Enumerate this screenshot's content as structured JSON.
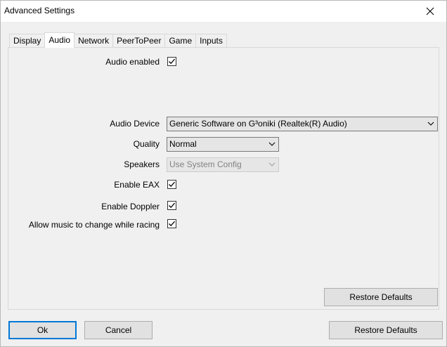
{
  "window": {
    "title": "Advanced Settings"
  },
  "tabs": [
    {
      "label": "Display"
    },
    {
      "label": "Audio"
    },
    {
      "label": "Network"
    },
    {
      "label": "PeerToPeer"
    },
    {
      "label": "Game"
    },
    {
      "label": "Inputs"
    }
  ],
  "active_tab": "Audio",
  "audio": {
    "audio_enabled_label": "Audio enabled",
    "audio_enabled": true,
    "audio_device_label": "Audio Device",
    "audio_device_value": "Generic Software on G³oniki (Realtek(R) Audio)",
    "quality_label": "Quality",
    "quality_value": "Normal",
    "speakers_label": "Speakers",
    "speakers_value": "Use System Config",
    "speakers_disabled": true,
    "eax_label": "Enable EAX",
    "eax_checked": true,
    "doppler_label": "Enable Doppler",
    "doppler_checked": true,
    "music_label": "Allow music to change while racing",
    "music_checked": true,
    "restore_defaults_label": "Restore Defaults"
  },
  "footer": {
    "ok_label": "Ok",
    "cancel_label": "Cancel",
    "restore_defaults_label": "Restore Defaults"
  },
  "icons": {
    "close": "close-icon",
    "check": "checkmark-icon",
    "dropdown": "chevron-down-icon"
  },
  "colors": {
    "focus_border": "#0078d7",
    "window_bg": "#f0f0f0"
  }
}
